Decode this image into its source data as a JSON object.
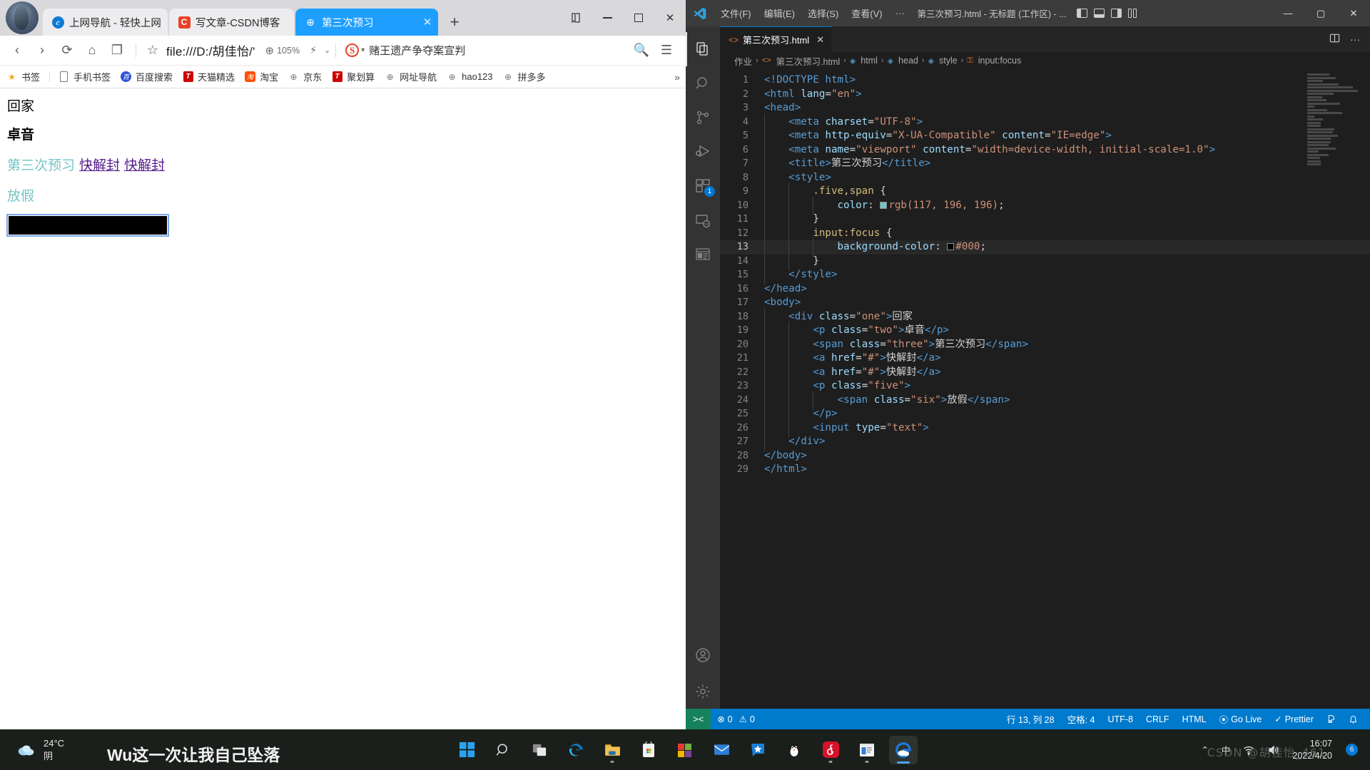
{
  "browser": {
    "tabs": [
      {
        "title": "上网导航 - 轻快上网",
        "favicon": "edge-icon",
        "active": false
      },
      {
        "title": "写文章-CSDN博客",
        "favicon": "csdn-icon",
        "active": false
      },
      {
        "title": "第三次预习",
        "favicon": "globe-icon",
        "active": true
      }
    ],
    "new_tab_label": "+",
    "window_controls": {
      "collections": "⊓",
      "minimize": "—",
      "maximize": "▢",
      "close": "✕"
    },
    "toolbar": {
      "back": "‹",
      "forward": "›",
      "reload": "⟳",
      "home": "⌂",
      "reader": "❐",
      "star": "☆",
      "url": "file:///D:/胡佳怡/'",
      "zoom_level": "105%",
      "bolt": "⚡",
      "caret": "⌄",
      "news_text": "赌王遗产争夺案宣判",
      "search": "🔍",
      "menu": "☰"
    },
    "bookmarks": [
      {
        "label": "书签",
        "icon": "star-icon"
      },
      {
        "label": "手机书签",
        "icon": "phone-icon"
      },
      {
        "label": "百度搜索",
        "icon": "baidu-icon"
      },
      {
        "label": "天猫精选",
        "icon": "tmall-icon"
      },
      {
        "label": "淘宝",
        "icon": "taobao-icon"
      },
      {
        "label": "京东",
        "icon": "globe-icon"
      },
      {
        "label": "聚划算",
        "icon": "tmall-icon"
      },
      {
        "label": "网址导航",
        "icon": "globe-icon"
      },
      {
        "label": "hao123",
        "icon": "globe-icon"
      },
      {
        "label": "拼多多",
        "icon": "globe-icon"
      }
    ],
    "bookmarks_overflow": "»",
    "page": {
      "div_one": "回家",
      "p_two": "卓音",
      "span_three": "第三次预习",
      "link_a": "快解封",
      "link_b": "快解封",
      "p_five_span_six": "放假",
      "input_value": "",
      "input_placeholder": ""
    }
  },
  "vscode": {
    "menu": [
      "文件(F)",
      "编辑(E)",
      "选择(S)",
      "查看(V)",
      "···"
    ],
    "window_title": "第三次预习.html - 无标题 (工作区) - ...",
    "window_controls": {
      "minimize": "—",
      "maximize": "▢",
      "close": "✕"
    },
    "tab": {
      "label": "第三次预习.html",
      "close": "✕",
      "icon": "html-file-icon"
    },
    "tab_actions": {
      "split": "▥",
      "more": "···"
    },
    "breadcrumb": [
      "作业",
      "第三次预习.html",
      "html",
      "head",
      "style",
      "input:focus"
    ],
    "activity_bar": [
      {
        "name": "explorer-icon",
        "badge": ""
      },
      {
        "name": "search-icon",
        "badge": ""
      },
      {
        "name": "source-control-icon",
        "badge": ""
      },
      {
        "name": "run-debug-icon",
        "badge": ""
      },
      {
        "name": "extensions-icon",
        "badge": "1"
      },
      {
        "name": "remote-explorer-icon",
        "badge": ""
      },
      {
        "name": "live-preview-icon",
        "badge": ""
      },
      {
        "name": "account-icon",
        "badge": ""
      },
      {
        "name": "settings-gear-icon",
        "badge": ""
      }
    ],
    "status_bar": {
      "remote": "><",
      "errors": "0",
      "warnings": "0",
      "cursor": "行 13, 列 28",
      "indent": "空格: 4",
      "encoding": "UTF-8",
      "eol": "CRLF",
      "language": "HTML",
      "go_live": "Go Live",
      "prettier": "Prettier",
      "broadcast": "⚲",
      "bell": "🔔"
    },
    "code": {
      "language": "html",
      "current_line": 13,
      "lines": [
        {
          "n": 1,
          "indent": 0,
          "tokens": [
            [
              "tg",
              "<!DOCTYPE "
            ],
            [
              "tn",
              "html"
            ],
            [
              "tg",
              ">"
            ]
          ]
        },
        {
          "n": 2,
          "indent": 0,
          "tokens": [
            [
              "tg",
              "<"
            ],
            [
              "tn",
              "html"
            ],
            [
              "pl",
              " "
            ],
            [
              "at",
              "lang"
            ],
            [
              "op",
              "="
            ],
            [
              "st",
              "\"en\""
            ],
            [
              "tg",
              ">"
            ]
          ]
        },
        {
          "n": 3,
          "indent": 0,
          "tokens": [
            [
              "tg",
              "<"
            ],
            [
              "tn",
              "head"
            ],
            [
              "tg",
              ">"
            ]
          ]
        },
        {
          "n": 4,
          "indent": 1,
          "tokens": [
            [
              "tg",
              "<"
            ],
            [
              "tn",
              "meta"
            ],
            [
              "pl",
              " "
            ],
            [
              "at",
              "charset"
            ],
            [
              "op",
              "="
            ],
            [
              "st",
              "\"UTF-8\""
            ],
            [
              "tg",
              ">"
            ]
          ]
        },
        {
          "n": 5,
          "indent": 1,
          "tokens": [
            [
              "tg",
              "<"
            ],
            [
              "tn",
              "meta"
            ],
            [
              "pl",
              " "
            ],
            [
              "at",
              "http-equiv"
            ],
            [
              "op",
              "="
            ],
            [
              "st",
              "\"X-UA-Compatible\""
            ],
            [
              "pl",
              " "
            ],
            [
              "at",
              "content"
            ],
            [
              "op",
              "="
            ],
            [
              "st",
              "\"IE=edge\""
            ],
            [
              "tg",
              ">"
            ]
          ]
        },
        {
          "n": 6,
          "indent": 1,
          "tokens": [
            [
              "tg",
              "<"
            ],
            [
              "tn",
              "meta"
            ],
            [
              "pl",
              " "
            ],
            [
              "at",
              "name"
            ],
            [
              "op",
              "="
            ],
            [
              "st",
              "\"viewport\""
            ],
            [
              "pl",
              " "
            ],
            [
              "at",
              "content"
            ],
            [
              "op",
              "="
            ],
            [
              "st",
              "\"width=device-width, initial-scale=1.0\""
            ],
            [
              "tg",
              ">"
            ]
          ]
        },
        {
          "n": 7,
          "indent": 1,
          "tokens": [
            [
              "tg",
              "<"
            ],
            [
              "tn",
              "title"
            ],
            [
              "tg",
              ">"
            ],
            [
              "pl",
              "第三次预习"
            ],
            [
              "tg",
              "</"
            ],
            [
              "tn",
              "title"
            ],
            [
              "tg",
              ">"
            ]
          ]
        },
        {
          "n": 8,
          "indent": 1,
          "tokens": [
            [
              "tg",
              "<"
            ],
            [
              "tn",
              "style"
            ],
            [
              "tg",
              ">"
            ]
          ]
        },
        {
          "n": 9,
          "indent": 2,
          "tokens": [
            [
              "se",
              ".five,span"
            ],
            [
              "pl",
              " "
            ],
            [
              "op",
              "{"
            ]
          ]
        },
        {
          "n": 10,
          "indent": 3,
          "tokens": [
            [
              "pr",
              "color"
            ],
            [
              "op",
              ": "
            ],
            [
              "swatch",
              "#75c4c4"
            ],
            [
              "vl",
              "rgb(117, 196, 196)"
            ],
            [
              "op",
              ";"
            ]
          ]
        },
        {
          "n": 11,
          "indent": 2,
          "tokens": [
            [
              "op",
              "}"
            ]
          ]
        },
        {
          "n": 12,
          "indent": 2,
          "tokens": [
            [
              "se",
              "input:focus"
            ],
            [
              "pl",
              " "
            ],
            [
              "op",
              "{"
            ]
          ]
        },
        {
          "n": 13,
          "indent": 3,
          "tokens": [
            [
              "pr",
              "background-color"
            ],
            [
              "op",
              ": "
            ],
            [
              "swatch",
              "#000000"
            ],
            [
              "vl",
              "#000"
            ],
            [
              "op",
              ";"
            ]
          ]
        },
        {
          "n": 14,
          "indent": 2,
          "tokens": [
            [
              "op",
              "}"
            ]
          ]
        },
        {
          "n": 15,
          "indent": 1,
          "tokens": [
            [
              "tg",
              "</"
            ],
            [
              "tn",
              "style"
            ],
            [
              "tg",
              ">"
            ]
          ]
        },
        {
          "n": 16,
          "indent": 0,
          "tokens": [
            [
              "tg",
              "</"
            ],
            [
              "tn",
              "head"
            ],
            [
              "tg",
              ">"
            ]
          ]
        },
        {
          "n": 17,
          "indent": 0,
          "tokens": [
            [
              "tg",
              "<"
            ],
            [
              "tn",
              "body"
            ],
            [
              "tg",
              ">"
            ]
          ]
        },
        {
          "n": 18,
          "indent": 1,
          "tokens": [
            [
              "tg",
              "<"
            ],
            [
              "tn",
              "div"
            ],
            [
              "pl",
              " "
            ],
            [
              "at",
              "class"
            ],
            [
              "op",
              "="
            ],
            [
              "st",
              "\"one\""
            ],
            [
              "tg",
              ">"
            ],
            [
              "pl",
              "回家"
            ]
          ]
        },
        {
          "n": 19,
          "indent": 2,
          "tokens": [
            [
              "tg",
              "<"
            ],
            [
              "tn",
              "p"
            ],
            [
              "pl",
              " "
            ],
            [
              "at",
              "class"
            ],
            [
              "op",
              "="
            ],
            [
              "st",
              "\"two\""
            ],
            [
              "tg",
              ">"
            ],
            [
              "pl",
              "卓音"
            ],
            [
              "tg",
              "</"
            ],
            [
              "tn",
              "p"
            ],
            [
              "tg",
              ">"
            ]
          ]
        },
        {
          "n": 20,
          "indent": 2,
          "tokens": [
            [
              "tg",
              "<"
            ],
            [
              "tn",
              "span"
            ],
            [
              "pl",
              " "
            ],
            [
              "at",
              "class"
            ],
            [
              "op",
              "="
            ],
            [
              "st",
              "\"three\""
            ],
            [
              "tg",
              ">"
            ],
            [
              "pl",
              "第三次预习"
            ],
            [
              "tg",
              "</"
            ],
            [
              "tn",
              "span"
            ],
            [
              "tg",
              ">"
            ]
          ]
        },
        {
          "n": 21,
          "indent": 2,
          "tokens": [
            [
              "tg",
              "<"
            ],
            [
              "tn",
              "a"
            ],
            [
              "pl",
              " "
            ],
            [
              "at",
              "href"
            ],
            [
              "op",
              "="
            ],
            [
              "st",
              "\"#\""
            ],
            [
              "tg",
              ">"
            ],
            [
              "pl",
              "快解封"
            ],
            [
              "tg",
              "</"
            ],
            [
              "tn",
              "a"
            ],
            [
              "tg",
              ">"
            ]
          ]
        },
        {
          "n": 22,
          "indent": 2,
          "tokens": [
            [
              "tg",
              "<"
            ],
            [
              "tn",
              "a"
            ],
            [
              "pl",
              " "
            ],
            [
              "at",
              "href"
            ],
            [
              "op",
              "="
            ],
            [
              "st",
              "\"#\""
            ],
            [
              "tg",
              ">"
            ],
            [
              "pl",
              "快解封"
            ],
            [
              "tg",
              "</"
            ],
            [
              "tn",
              "a"
            ],
            [
              "tg",
              ">"
            ]
          ]
        },
        {
          "n": 23,
          "indent": 2,
          "tokens": [
            [
              "tg",
              "<"
            ],
            [
              "tn",
              "p"
            ],
            [
              "pl",
              " "
            ],
            [
              "at",
              "class"
            ],
            [
              "op",
              "="
            ],
            [
              "st",
              "\"five\""
            ],
            [
              "tg",
              ">"
            ]
          ]
        },
        {
          "n": 24,
          "indent": 3,
          "tokens": [
            [
              "tg",
              "<"
            ],
            [
              "tn",
              "span"
            ],
            [
              "pl",
              " "
            ],
            [
              "at",
              "class"
            ],
            [
              "op",
              "="
            ],
            [
              "st",
              "\"six\""
            ],
            [
              "tg",
              ">"
            ],
            [
              "pl",
              "放假"
            ],
            [
              "tg",
              "</"
            ],
            [
              "tn",
              "span"
            ],
            [
              "tg",
              ">"
            ]
          ]
        },
        {
          "n": 25,
          "indent": 2,
          "tokens": [
            [
              "tg",
              "</"
            ],
            [
              "tn",
              "p"
            ],
            [
              "tg",
              ">"
            ]
          ]
        },
        {
          "n": 26,
          "indent": 2,
          "tokens": [
            [
              "tg",
              "<"
            ],
            [
              "tn",
              "input"
            ],
            [
              "pl",
              " "
            ],
            [
              "at",
              "type"
            ],
            [
              "op",
              "="
            ],
            [
              "st",
              "\"text\""
            ],
            [
              "tg",
              ">"
            ]
          ]
        },
        {
          "n": 27,
          "indent": 1,
          "tokens": [
            [
              "tg",
              "</"
            ],
            [
              "tn",
              "div"
            ],
            [
              "tg",
              ">"
            ]
          ]
        },
        {
          "n": 28,
          "indent": 0,
          "tokens": [
            [
              "tg",
              "</"
            ],
            [
              "tn",
              "body"
            ],
            [
              "tg",
              ">"
            ]
          ]
        },
        {
          "n": 29,
          "indent": 0,
          "tokens": [
            [
              "tg",
              "</"
            ],
            [
              "tn",
              "html"
            ],
            [
              "tg",
              ">"
            ]
          ]
        }
      ]
    }
  },
  "taskbar": {
    "weather": {
      "temperature": "24°C",
      "condition": "阴"
    },
    "lyric": "Wu这一次让我自己坠落",
    "icons": [
      {
        "name": "start-windows-icon",
        "running": false
      },
      {
        "name": "search-icon",
        "running": false
      },
      {
        "name": "task-view-icon",
        "running": false
      },
      {
        "name": "edge-browser-icon",
        "running": false
      },
      {
        "name": "file-explorer-icon",
        "running": true
      },
      {
        "name": "microsoft-store-icon",
        "running": false
      },
      {
        "name": "windows-legacy-icon",
        "running": false
      },
      {
        "name": "mail-icon",
        "running": false
      },
      {
        "name": "xuexi-icon",
        "running": false
      },
      {
        "name": "qq-icon",
        "running": false
      },
      {
        "name": "netease-music-icon",
        "running": true
      },
      {
        "name": "vscode-taskbar-icon",
        "running": true
      },
      {
        "name": "sogou-browser-icon",
        "running": true
      }
    ],
    "tray": {
      "chevron": "⌃",
      "ime": "中",
      "wifi": "wifi-icon",
      "volume": "volume-icon",
      "time": "16:07",
      "date": "2022/4/20",
      "notification_count": "6"
    },
    "watermark": "CSDN @胡佳怡_461"
  },
  "colors": {
    "browser_active_tab": "#1e9fff",
    "vscode_accent": "#007acc",
    "vscode_remote": "#16825d",
    "page_teal": "#75c4c4",
    "link_purple": "#551a8b"
  }
}
